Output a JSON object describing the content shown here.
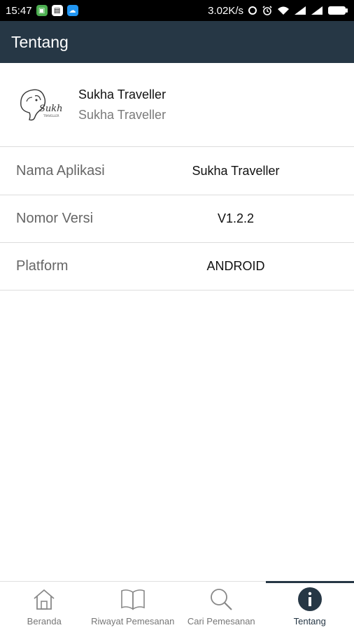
{
  "status_bar": {
    "time": "15:47",
    "network_speed": "3.02K/s",
    "battery": "battery-icon"
  },
  "app_bar": {
    "title": "Tentang"
  },
  "app_header": {
    "name": "Sukha Traveller",
    "subtitle": "Sukha Traveller",
    "logo": "elephant-logo-icon"
  },
  "info": {
    "rows": [
      {
        "label": "Nama Aplikasi",
        "value": "Sukha Traveller"
      },
      {
        "label": "Nomor Versi",
        "value": "V1.2.2"
      },
      {
        "label": "Platform",
        "value": "ANDROID"
      }
    ]
  },
  "bottom_nav": {
    "items": [
      {
        "label": "Beranda",
        "icon": "home-icon"
      },
      {
        "label": "Riwayat Pemesanan",
        "icon": "book-icon"
      },
      {
        "label": "Cari Pemesanan",
        "icon": "search-icon"
      },
      {
        "label": "Tentang",
        "icon": "info-icon",
        "active": true
      }
    ]
  },
  "colors": {
    "primary": "#263745",
    "divider": "#dddddd"
  }
}
